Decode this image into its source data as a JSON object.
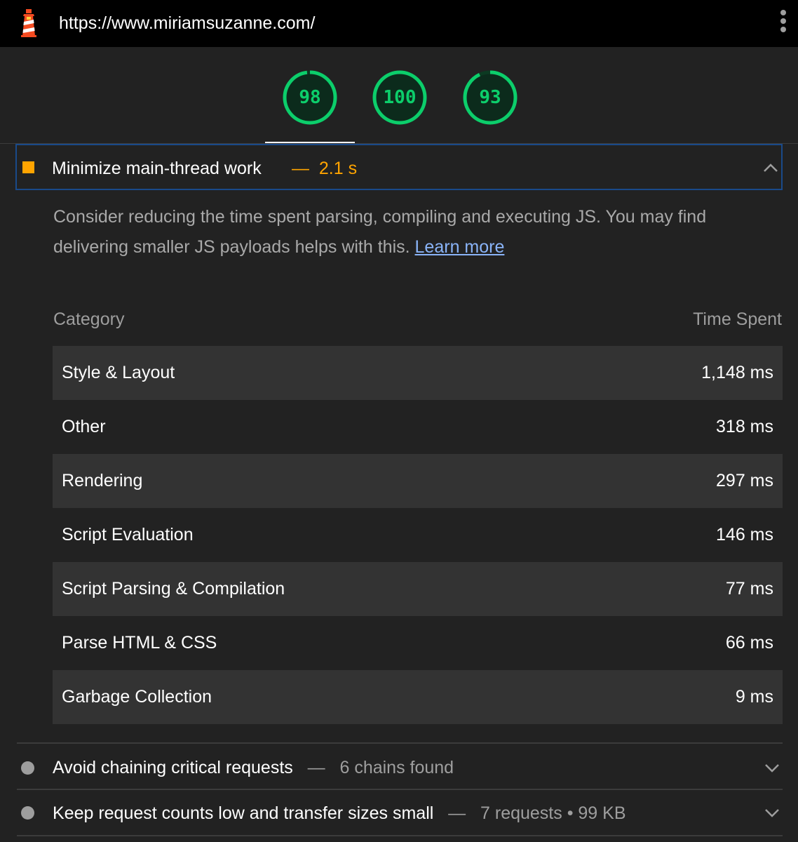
{
  "browser": {
    "url": "https://www.miriamsuzanne.com/"
  },
  "colors": {
    "pass": "#0cce6b",
    "average": "#ffa400",
    "neutral": "#9e9e9e",
    "link": "#8ab4f8"
  },
  "scores": [
    {
      "value": "98",
      "fraction": 0.98
    },
    {
      "value": "100",
      "fraction": 1.0
    },
    {
      "value": "93",
      "fraction": 0.93
    }
  ],
  "audit": {
    "title": "Minimize main-thread work",
    "separator": "—",
    "display_value": "2.1 s",
    "description": "Consider reducing the time spent parsing, compiling and executing JS. You may find delivering smaller JS payloads helps with this.",
    "learn_more": "Learn more",
    "table": {
      "headers": {
        "category": "Category",
        "time": "Time Spent"
      },
      "rows": [
        {
          "category": "Style & Layout",
          "time": "1,148 ms"
        },
        {
          "category": "Other",
          "time": "318 ms"
        },
        {
          "category": "Rendering",
          "time": "297 ms"
        },
        {
          "category": "Script Evaluation",
          "time": "146 ms"
        },
        {
          "category": "Script Parsing & Compilation",
          "time": "77 ms"
        },
        {
          "category": "Parse HTML & CSS",
          "time": "66 ms"
        },
        {
          "category": "Garbage Collection",
          "time": "9 ms"
        }
      ]
    }
  },
  "other_audits": [
    {
      "title": "Avoid chaining critical requests",
      "separator": "—",
      "value": "6 chains found"
    },
    {
      "title": "Keep request counts low and transfer sizes small",
      "separator": "—",
      "value": "7 requests • 99 KB"
    }
  ]
}
